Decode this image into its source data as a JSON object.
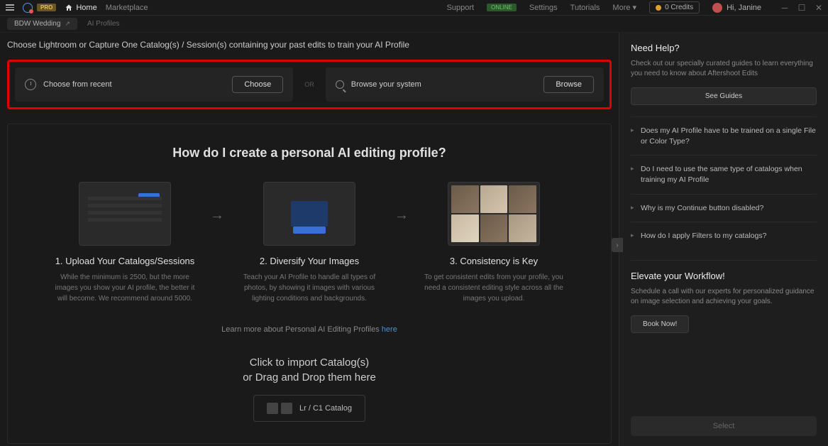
{
  "topbar": {
    "pro_badge": "PRO",
    "home_label": "Home",
    "marketplace_label": "Marketplace",
    "support_label": "Support",
    "online_badge": "ONLINE",
    "settings_label": "Settings",
    "tutorials_label": "Tutorials",
    "more_label": "More ▾",
    "credits_label": "0 Credits",
    "greeting": "Hi, Janine"
  },
  "subbar": {
    "project_name": "BDW Wedding",
    "breadcrumb": "AI Profiles"
  },
  "instruction": "Choose Lightroom or Capture One Catalog(s) / Session(s) containing your past edits to train your AI Profile",
  "selectors": {
    "recent_label": "Choose from recent",
    "choose_btn": "Choose",
    "or_text": "OR",
    "browse_label": "Browse your system",
    "browse_btn": "Browse"
  },
  "guide": {
    "title": "How do I create a personal AI editing profile?",
    "steps": [
      {
        "title": "1. Upload Your Catalogs/Sessions",
        "desc": "While the minimum is 2500, but the more images you show your AI profile, the better it will become. We recommend around 5000."
      },
      {
        "title": "2. Diversify Your Images",
        "desc": "Teach your AI Profile to handle all types of photos, by showing it images with various lighting conditions and backgrounds."
      },
      {
        "title": "3. Consistency is Key",
        "desc": "To get consistent edits from your profile, you need a consistent editing style across all the images you upload."
      }
    ],
    "learn_more_prefix": "Learn more about Personal AI Editing Profiles ",
    "learn_more_link": "here",
    "import_title_l1": "Click to import Catalog(s)",
    "import_title_l2": "or Drag and Drop them here",
    "import_chip": "Lr / C1 Catalog"
  },
  "help": {
    "title": "Need Help?",
    "desc": "Check out our specially curated guides to learn everything you need to know about Aftershoot Edits",
    "see_guides_btn": "See Guides",
    "faqs": [
      "Does my AI Profile have to be trained on a single File or Color Type?",
      "Do I need to use the same type of catalogs when training my AI Profile",
      "Why is my Continue button disabled?",
      "How do I apply Filters to my catalogs?"
    ],
    "elevate_title": "Elevate your Workflow!",
    "elevate_desc": "Schedule a call with our experts for personalized guidance on image selection and achieving your goals.",
    "book_btn": "Book Now!",
    "select_btn": "Select"
  }
}
